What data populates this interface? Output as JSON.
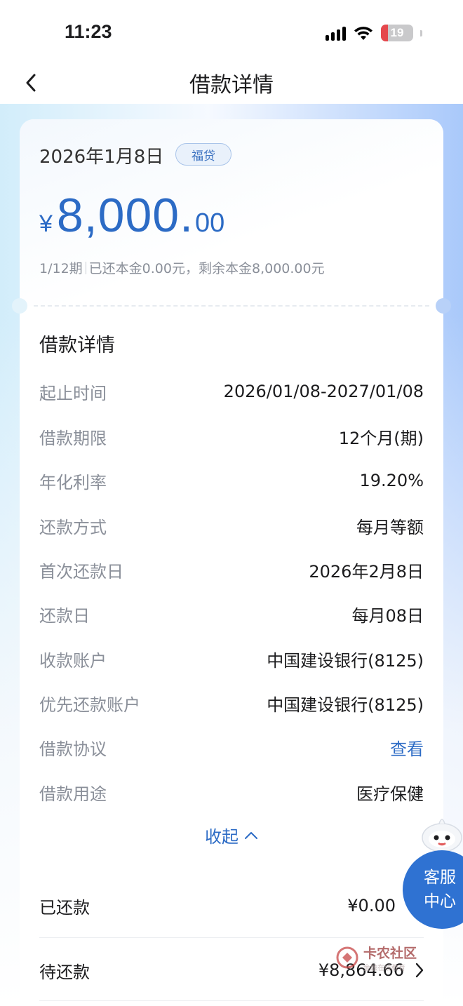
{
  "status_bar": {
    "time": "11:23",
    "battery": "19"
  },
  "nav": {
    "title": "借款详情"
  },
  "loan": {
    "date": "2026年1月8日",
    "tag": "福贷",
    "currency": "¥",
    "amount_int": "8,000.",
    "amount_dec": "00",
    "summary_period": "1/12期",
    "summary_detail": "已还本金0.00元，剩余本金8,000.00元"
  },
  "details": {
    "title": "借款详情",
    "rows": [
      {
        "label": "起止时间",
        "value": "2026/01/08-2027/01/08"
      },
      {
        "label": "借款期限",
        "value": "12个月(期)"
      },
      {
        "label": "年化利率",
        "value": "19.20%"
      },
      {
        "label": "还款方式",
        "value": "每月等额"
      },
      {
        "label": "首次还款日",
        "value": "2026年2月8日"
      },
      {
        "label": "还款日",
        "value": "每月08日"
      },
      {
        "label": "收款账户",
        "value": "中国建设银行(8125)"
      },
      {
        "label": "优先还款账户",
        "value": "中国建设银行(8125)"
      },
      {
        "label": "借款协议",
        "value": "查看"
      },
      {
        "label": "借款用途",
        "value": "医疗保健"
      }
    ],
    "collapse_label": "收起"
  },
  "repayment": {
    "paid_label": "已还款",
    "paid_value": "¥0.00",
    "pending_label": "待还款",
    "pending_value": "¥8,864.66"
  },
  "service": {
    "line1": "客服",
    "line2": "中心"
  },
  "watermark": {
    "title": "卡农社区",
    "subtitle": "金融在线教育"
  },
  "colors": {
    "accent": "#2c6bc5",
    "service_button": "#2f72d2",
    "label_gray": "#8a8f99"
  }
}
